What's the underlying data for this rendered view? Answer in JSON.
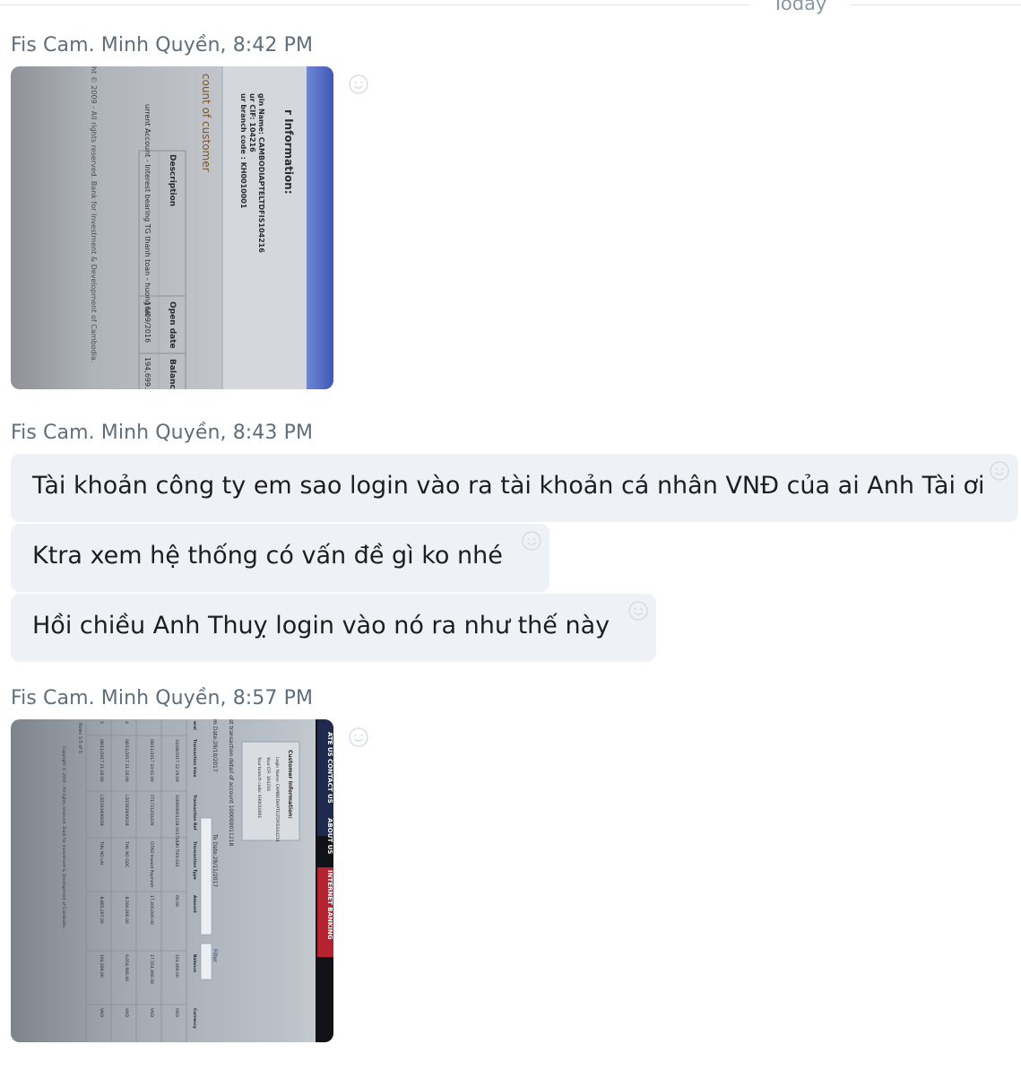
{
  "divider": {
    "label": "Today"
  },
  "messages": [
    {
      "sender": "Fis Cam. Minh Quyền",
      "time": "8:42 PM",
      "type": "photo",
      "photo_text": {
        "title": "r Information:",
        "login": "gin Name: CAMBODIAPTELTDFIS104216",
        "cif": "ur CIF: 104216",
        "branch": "ur branch code : KH0010001",
        "section": "count of customer",
        "col_desc": "Description",
        "col_open": "Open date",
        "col_bal": "Balanc",
        "row_desc": "urrent Account - Interest bearing TG thanh toan - huong lai",
        "row_open": "16/09/2016",
        "row_bal": "194,699.",
        "footer": "ht © 2009 - All rights reserved. Bank for Investment & Development of Cambodia."
      }
    },
    {
      "sender": "Fis Cam. Minh Quyền",
      "time": "8:43 PM",
      "type": "text",
      "bubbles": [
        "Tài khoản công ty em sao login vào ra tài khoản cá nhân VNĐ của ai Anh Tài ơi",
        "Ktra xem hệ thống có vấn đề gì ko nhé",
        "Hồi chiều Anh Thuỵ login vào nó ra như thế này"
      ]
    },
    {
      "sender": "Fis Cam. Minh Quyền",
      "time": "8:57 PM",
      "type": "photo",
      "photo_text": {
        "nav": [
          "ATE US",
          "CONTACT US",
          "ABOUT US",
          "INTERNET BANKING"
        ],
        "customer_info": "Customer Information:",
        "login": "Login Name: CAMBODIAPTELTDFIS104216",
        "cif": "Your CIF: 104216",
        "branch": "Your branch code: KH0010001",
        "txn_title": "st transaction detail of account 100000011218",
        "from_date": "m Date:29/10/2017",
        "to_date": "To Date:29/11/2017",
        "filter": "Filter",
        "headers": [
          "eral",
          "Transaction time",
          "Transaction Ref",
          "Transaction Type",
          "Amount",
          "Balance",
          "Currency"
        ],
        "rows": [
          [
            "",
            "31/08/2017 22:29:00",
            "100000001218-2017103",
            "LAI TIEN GUI",
            "66.00",
            "154,966.00",
            "VND"
          ],
          [
            "",
            "08/11/2017 10:01:00",
            "FT17312Q4109",
            "CITAD Inward Payment",
            "17,400,000.00",
            "17,554,966.00",
            "VND"
          ],
          [
            "4",
            "08/11/2017 21:16:00",
            "LD1563600018",
            "THU NO GOC",
            "-8,500,000.00",
            "9,054,966.00",
            "VND"
          ],
          [
            "5",
            "08/11/2017 21:16:00",
            "LD1563600018",
            "THU NO LAI",
            "-8,860,267.00",
            "194,699.00",
            "VND"
          ]
        ],
        "rows_count": "Rows 1-5 of 5",
        "copyright": "Copyright © 2009 - All rights reserved. Bank for Investment & Development of Cambodia."
      }
    }
  ],
  "colors": {
    "bubble_bg": "#eef2f6",
    "sender_text": "#5f6e7a",
    "nav_red": "#b52330"
  }
}
